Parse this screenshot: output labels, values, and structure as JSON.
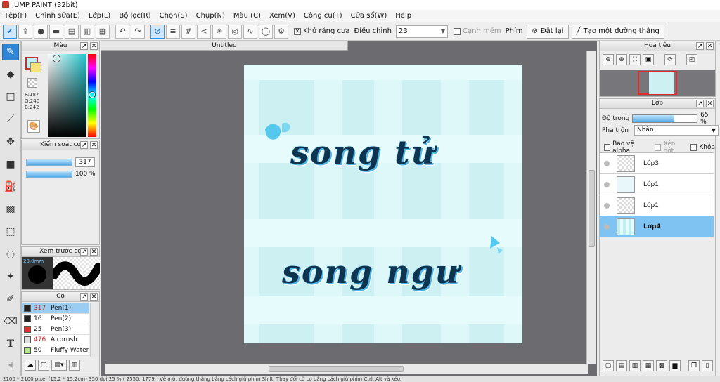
{
  "window": {
    "title": "JUMP PAINT (32bit)"
  },
  "menu": [
    "Tệp(F)",
    "Chỉnh sửa(E)",
    "Lớp(L)",
    "Bộ lọc(R)",
    "Chọn(S)",
    "Chụp(N)",
    "Màu (C)",
    "Xem(V)",
    "Công cụ(T)",
    "Cửa sổ(W)",
    "Help"
  ],
  "toolbar": {
    "antialias_label": "Khử răng cưa",
    "adjust_label": "Điều chỉnh",
    "adjust_value": "23",
    "edge_label": "Cạnh mềm",
    "key_label": "Phím",
    "reset_label": "Đặt lại",
    "straight_label": "Tạo một đường thẳng"
  },
  "color_panel": {
    "title": "Màu",
    "r": "R:187",
    "g": "G:240",
    "b": "B:242",
    "primary": "#bbf0f2",
    "secondary": "#f5e27a"
  },
  "brush_control": {
    "title": "Kiểm soát cọ",
    "size": "317",
    "opacity": "100 %"
  },
  "brush_preview": {
    "title": "Xem trước cọ",
    "size_text": "23.0mm"
  },
  "brush_list": {
    "title": "Cọ",
    "items": [
      {
        "size": "317",
        "name": "Pen(1)",
        "color": "#222222"
      },
      {
        "size": "16",
        "name": "Pen(2)",
        "color": "#222222"
      },
      {
        "size": "25",
        "name": "Pen(3)",
        "color": "#e03030"
      },
      {
        "size": "476",
        "name": "Airbrush",
        "color": "#e0e0e0"
      },
      {
        "size": "50",
        "name": "Fluffy Water",
        "color": "#b8e986"
      }
    ]
  },
  "document": {
    "tab_title": "Untitled",
    "line1": "song tử",
    "line2": "song ngư"
  },
  "navigator": {
    "title": "Hoa tiêu"
  },
  "layer_panel": {
    "title": "Lớp",
    "opacity_label": "Độ trong",
    "opacity_value": "65 %",
    "opacity_fraction": 0.65,
    "blend_label": "Pha trộn",
    "blend_value": "Nhân",
    "protect_alpha": "Bảo vệ alpha",
    "clip_label": "Xén bớt",
    "lock_label": "Khóa",
    "layers": [
      {
        "name": "Lớp3"
      },
      {
        "name": "Lớp1"
      },
      {
        "name": "Lớp1"
      },
      {
        "name": "Lớp4"
      }
    ]
  },
  "status": "2100 * 2100 pixel  (15.2 * 15.2cm)  350 dpi  25 %  ( 2550, 1779 )  Vẽ một đường thẳng bằng cách giữ phím Shift. Thay đổi cỡ cọ bằng cách giữ phím Ctrl, Alt và kéo."
}
